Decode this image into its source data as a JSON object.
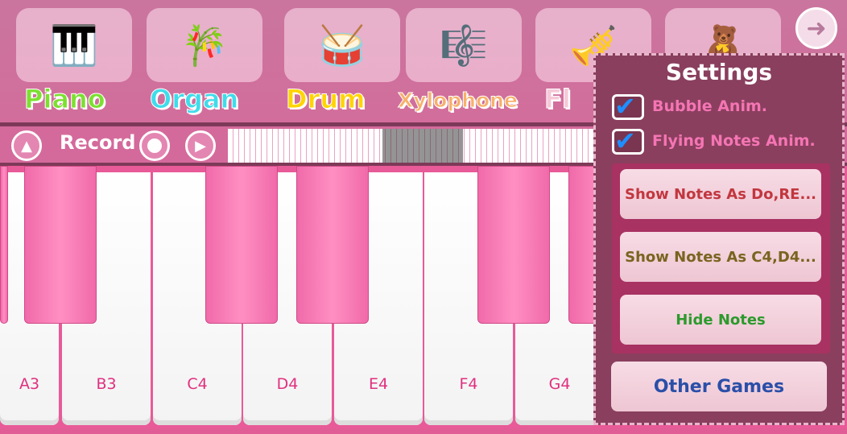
{
  "instruments": [
    {
      "label": "Piano",
      "icon": "piano-icon",
      "color": "#7be02f"
    },
    {
      "label": "Organ",
      "icon": "pan-flute-icon",
      "color": "#3fdcea"
    },
    {
      "label": "Drum",
      "icon": "drum-icon",
      "color": "#ffd400"
    },
    {
      "label": "Xylophone",
      "icon": "xylophone-icon",
      "color": "#f7b06a"
    },
    {
      "label": "Fl",
      "icon": "flute-icon",
      "color": "#f6c9d8"
    },
    {
      "label": "",
      "icon": "toys-icon",
      "color": ""
    }
  ],
  "controls": {
    "record_label": "Record"
  },
  "keyboard": {
    "white_keys": [
      "",
      "A3",
      "B3",
      "C4",
      "D4",
      "E4",
      "F4",
      "G4"
    ]
  },
  "settings": {
    "title": "Settings",
    "bubble_anim": {
      "label": "Bubble Anim.",
      "checked": true
    },
    "flying_notes_anim": {
      "label": "Flying Notes Anim.",
      "checked": true
    },
    "show_do_re": "Show Notes As Do,RE...",
    "show_c4_d4": "Show Notes As C4,D4...",
    "hide_notes": "Hide Notes",
    "other_games": "Other Games"
  }
}
